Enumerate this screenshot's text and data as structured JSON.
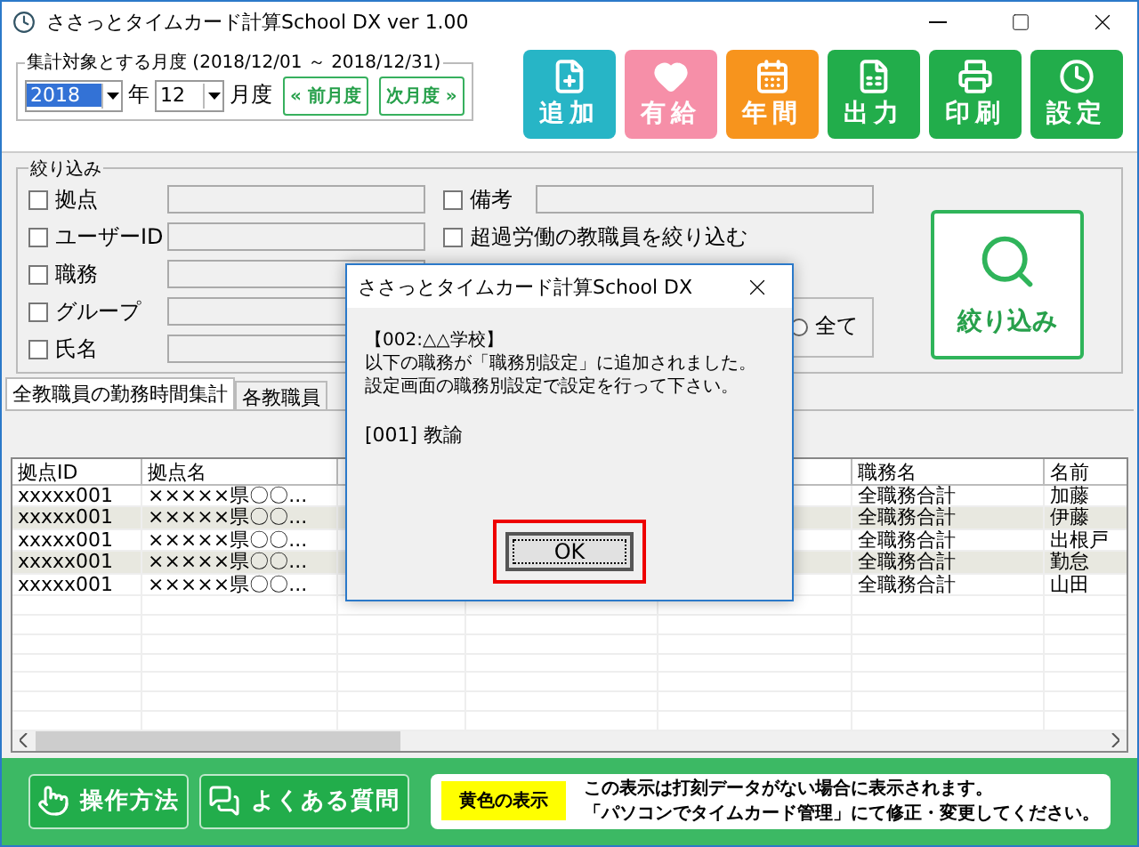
{
  "window": {
    "title": "ささっとタイムカード計算School DX ver 1.00"
  },
  "period": {
    "legend": "集計対象とする月度 (2018/12/01 ～ 2018/12/31)",
    "year": "2018",
    "year_unit": "年",
    "month": "12",
    "month_unit": "月度",
    "prev": "« 前月度",
    "next": "次月度 »"
  },
  "toolbar": [
    {
      "label": "追加",
      "kind": "add",
      "color": "#27b5c6"
    },
    {
      "label": "有給",
      "kind": "leave",
      "color": "#f68fa8"
    },
    {
      "label": "年間",
      "kind": "year",
      "color": "#f7941d"
    },
    {
      "label": "出力",
      "kind": "export",
      "color": "#22ad4b"
    },
    {
      "label": "印刷",
      "kind": "print",
      "color": "#22ad4b"
    },
    {
      "label": "設定",
      "kind": "settings",
      "color": "#22ad4b"
    }
  ],
  "filter": {
    "legend": "絞り込み",
    "fields": [
      {
        "label": "拠点",
        "checked": false
      },
      {
        "label": "ユーザーID",
        "checked": false
      },
      {
        "label": "職務",
        "checked": false
      },
      {
        "label": "グループ",
        "checked": false
      },
      {
        "label": "氏名",
        "checked": false
      }
    ],
    "memo": {
      "label": "備考",
      "checked": false
    },
    "overtime": {
      "label": "超過労働の教職員を絞り込む",
      "checked": false
    },
    "radios": [
      {
        "label": "全て",
        "selected": false
      }
    ],
    "button": "絞り込み"
  },
  "tabs": [
    {
      "label": "全教職員の勤務時間集計",
      "selected": true
    },
    {
      "label": "各教職員",
      "selected": false
    }
  ],
  "table": {
    "columns": [
      "拠点ID",
      "拠点名",
      "職務名",
      "名前"
    ],
    "rows": [
      [
        "xxxxx001",
        "×××××県〇〇...",
        "全職務合計",
        "加藤"
      ],
      [
        "xxxxx001",
        "×××××県〇〇...",
        "全職務合計",
        "伊藤"
      ],
      [
        "xxxxx001",
        "×××××県〇〇...",
        "全職務合計",
        "出根戸"
      ],
      [
        "xxxxx001",
        "×××××県〇〇...",
        "全職務合計",
        "勤怠"
      ],
      [
        "xxxxx001",
        "×××××県〇〇...",
        "全職務合計",
        "山田"
      ]
    ]
  },
  "dialog": {
    "title": "ささっとタイムカード計算School DX",
    "lines": [
      "【002:△△学校】",
      "以下の職務が「職務別設定」に追加されました。",
      "設定画面の職務別設定で設定を行って下さい。"
    ],
    "item": "[001] 教諭",
    "ok": "OK"
  },
  "footer": {
    "buttons": [
      {
        "label": "操作方法",
        "kind": "help"
      },
      {
        "label": "よくある質問",
        "kind": "faq"
      }
    ],
    "tag": "黄色の表示",
    "lines": [
      "この表示は打刻データがない場合に表示されます。",
      "「パソコンでタイムカード管理」にて修正・変更してください。"
    ]
  }
}
